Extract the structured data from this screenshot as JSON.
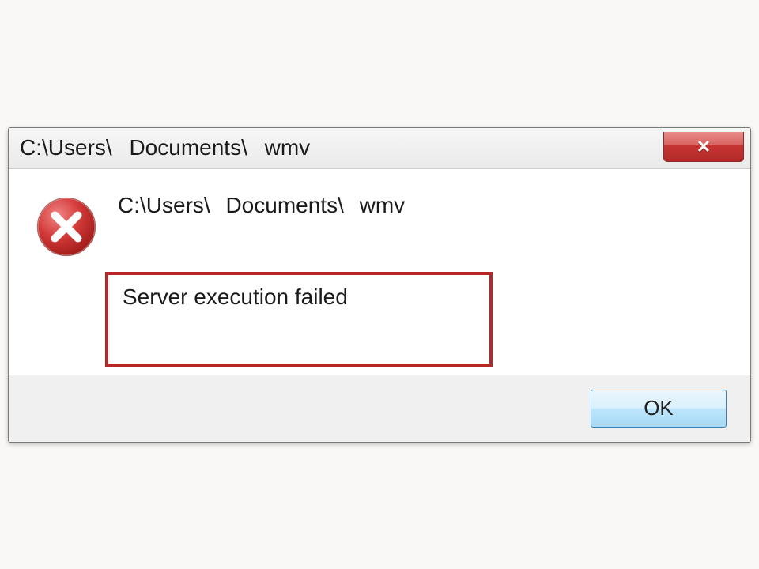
{
  "title": "C:\\Users\\ Documents\\ wmv",
  "body": {
    "path": "C:\\Users\\ Documents\\ wmv",
    "message": "Server execution failed"
  },
  "buttons": {
    "ok": "OK"
  }
}
